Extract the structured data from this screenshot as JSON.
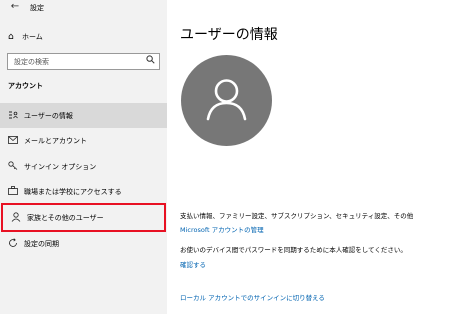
{
  "window": {
    "title": "設定",
    "back_icon": "back-arrow-icon"
  },
  "sidebar": {
    "home": {
      "label": "ホーム",
      "icon": "home-icon"
    },
    "search": {
      "placeholder": "設定の検索",
      "icon": "search-icon"
    },
    "section_title": "アカウント",
    "items": [
      {
        "label": "ユーザーの情報",
        "icon": "user-info-icon",
        "active": true
      },
      {
        "label": "メールとアカウント",
        "icon": "mail-icon"
      },
      {
        "label": "サインイン オプション",
        "icon": "key-icon"
      },
      {
        "label": "職場または学校にアクセスする",
        "icon": "briefcase-icon"
      },
      {
        "label": "家族とその他のユーザー",
        "icon": "person-icon",
        "highlighted": true
      },
      {
        "label": "設定の同期",
        "icon": "sync-icon"
      }
    ]
  },
  "main": {
    "title": "ユーザーの情報",
    "avatar_icon": "person-avatar-icon",
    "billing_text": "支払い情報、ファミリー設定、サブスクリプション、セキュリティ設定、その他",
    "manage_link": "Microsoft アカウントの管理",
    "sync_text": "お使いのデバイス間でパスワードを同期するために本人確認をしてください。",
    "verify_link": "確認する",
    "local_link": "ローカル アカウントでのサインインに切り替える"
  },
  "colors": {
    "accent_link": "#0063b1",
    "highlight_border": "#e81123",
    "avatar_bg": "#777777"
  }
}
